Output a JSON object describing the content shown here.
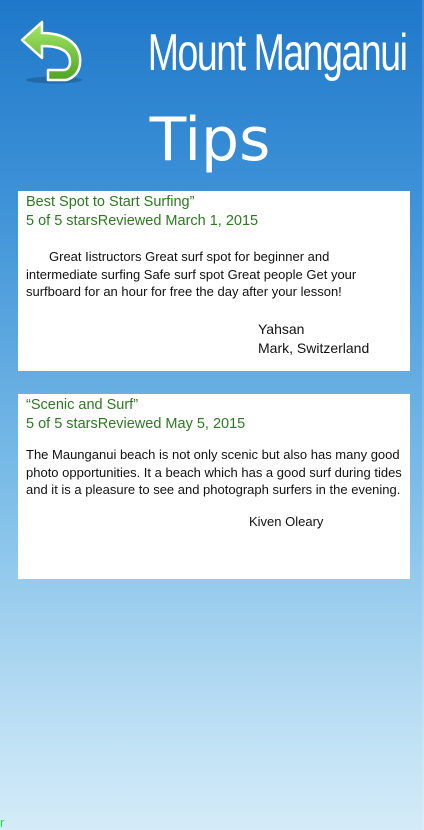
{
  "header": {
    "back_icon": "back-arrow-icon",
    "title": "Mount Manganui",
    "subtitle": "Tips"
  },
  "reviews": [
    {
      "title": "Best Spot to Start Surfing”",
      "rating": "5 of 5 starsReviewed March 1, 2015",
      "body": "Great Iistructors Great surf spot for beginner and intermediate surfing Safe surf spot Great people Get your surfboard for an hour for free the day after your lesson!",
      "author_name": "Yahsan",
      "author_location": "Mark, Switzerland"
    },
    {
      "title": "“Scenic and Surf”",
      "rating": "5 of 5 starsReviewed May 5, 2015",
      "body": "The Maunganui beach is not only scenic but also has many good photo opportunities. It a beach which has a good surf during tides and it is a pleasure to see and photograph surfers in the evening.",
      "author_name": "Kiven Oleary"
    }
  ],
  "colors": {
    "review_heading": "#2c7a1f",
    "back_arrow": "#7ad13a",
    "background_top": "#1f78c9",
    "background_bottom": "#d4ebf8"
  },
  "corner_mark": "r"
}
